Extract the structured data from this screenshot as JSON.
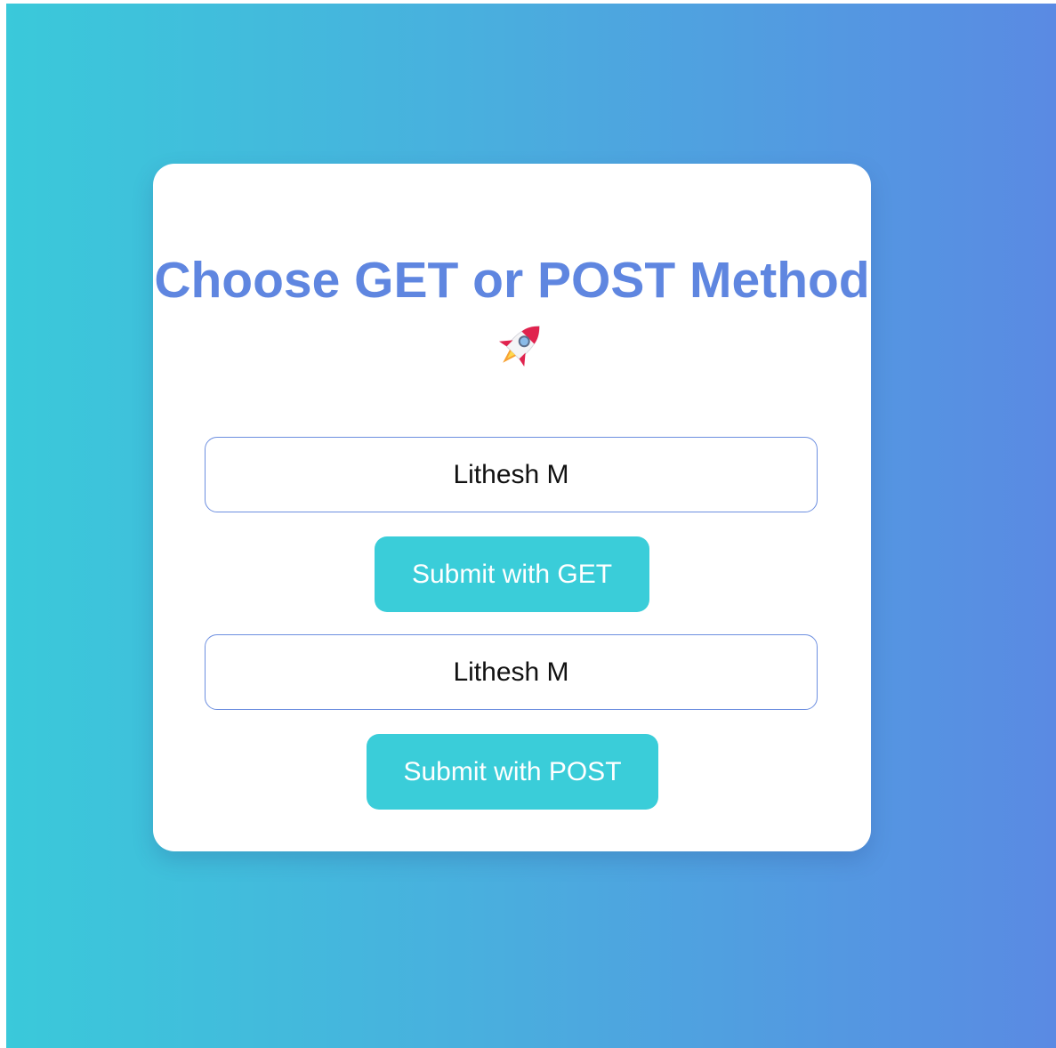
{
  "title": {
    "text": "Choose GET or POST Method",
    "icon": "rocket-icon"
  },
  "get_form": {
    "input_value": "Lithesh M",
    "button_label": "Submit with GET"
  },
  "post_form": {
    "input_value": "Lithesh M",
    "button_label": "Submit with POST"
  },
  "colors": {
    "background_start": "#3ac9da",
    "background_end": "#5a8ae3",
    "title": "#5f86e0",
    "button": "#3acdd9",
    "input_border": "#6d8fe0"
  }
}
